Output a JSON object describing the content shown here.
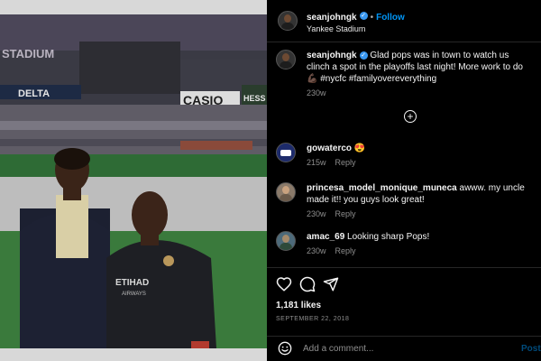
{
  "post": {
    "username": "seanjohngk",
    "follow_separator": "•",
    "follow_label": "Follow",
    "location": "Yankee Stadium",
    "photo_signs": {
      "stadium": "STADIUM",
      "delta": "DELTA",
      "casio": "CASIO",
      "hess": "HESS",
      "etihad": "ETIHAD",
      "airways": "AIRWAYS"
    },
    "caption": {
      "text": "Glad pops was in town to watch us clinch a spot in the playoffs last night! More work to do 💪🏿 #nycfc #familyovereverything",
      "age": "230w"
    },
    "load_more_icon": "plus-circle-icon",
    "comments": [
      {
        "username": "gowaterco",
        "text": "😍",
        "age": "215w",
        "reply": "Reply"
      },
      {
        "username": "princesa_model_monique_muneca",
        "text": "awww. my uncle made it!! you guys look great!",
        "age": "230w",
        "reply": "Reply"
      },
      {
        "username": "amac_69",
        "text": "Looking sharp Pops!",
        "age": "230w",
        "reply": "Reply"
      }
    ],
    "actions": [
      "heart-icon",
      "comment-icon",
      "share-icon"
    ],
    "likes": "1,181 likes",
    "date": "SEPTEMBER 22, 2018",
    "add_comment_placeholder": "Add a comment...",
    "post_label": "Post"
  },
  "colors": {
    "background": "#000000",
    "accent": "#0095f6",
    "muted": "#8e8e8e",
    "divider": "#262626",
    "verified": "#3897f0"
  }
}
